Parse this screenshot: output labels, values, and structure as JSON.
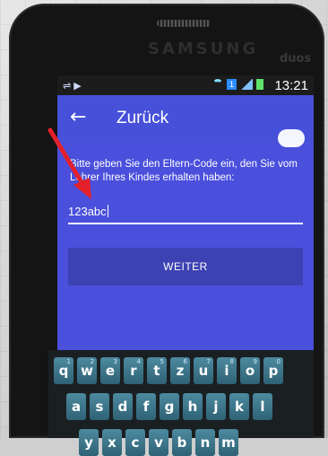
{
  "device": {
    "brand": "SAMSUNG",
    "model": "duos"
  },
  "statusbar": {
    "time": "13:21",
    "left_icons": [
      "usb-icon",
      "play-store-icon"
    ],
    "right_icons": [
      "wifi-icon",
      "sim-icon",
      "signal-icon",
      "battery-icon"
    ]
  },
  "appbar": {
    "back_icon": "arrow-left",
    "title": "Zurück"
  },
  "form": {
    "prompt": "Bitte geben Sie den Eltern-Code ein, den Sie vom Lehrer Ihres Kindes erhalten haben:",
    "code_value": "123abc",
    "submit_label": "WEITER"
  },
  "keyboard": {
    "row1": [
      {
        "key": "q",
        "num": "1"
      },
      {
        "key": "w",
        "num": "2"
      },
      {
        "key": "e",
        "num": "3"
      },
      {
        "key": "r",
        "num": "4"
      },
      {
        "key": "t",
        "num": "5"
      },
      {
        "key": "z",
        "num": "6"
      },
      {
        "key": "u",
        "num": "7"
      },
      {
        "key": "i",
        "num": "8"
      },
      {
        "key": "o",
        "num": "9"
      },
      {
        "key": "p",
        "num": "0"
      }
    ],
    "row2": [
      "a",
      "s",
      "d",
      "f",
      "g",
      "h",
      "j",
      "k",
      "l"
    ],
    "row3": [
      "y",
      "x",
      "c",
      "v",
      "b",
      "n",
      "m"
    ]
  },
  "colors": {
    "screen_bg": "#4a4fdc",
    "button_bg": "#3d42b2",
    "annotation_arrow": "#e3202b"
  }
}
